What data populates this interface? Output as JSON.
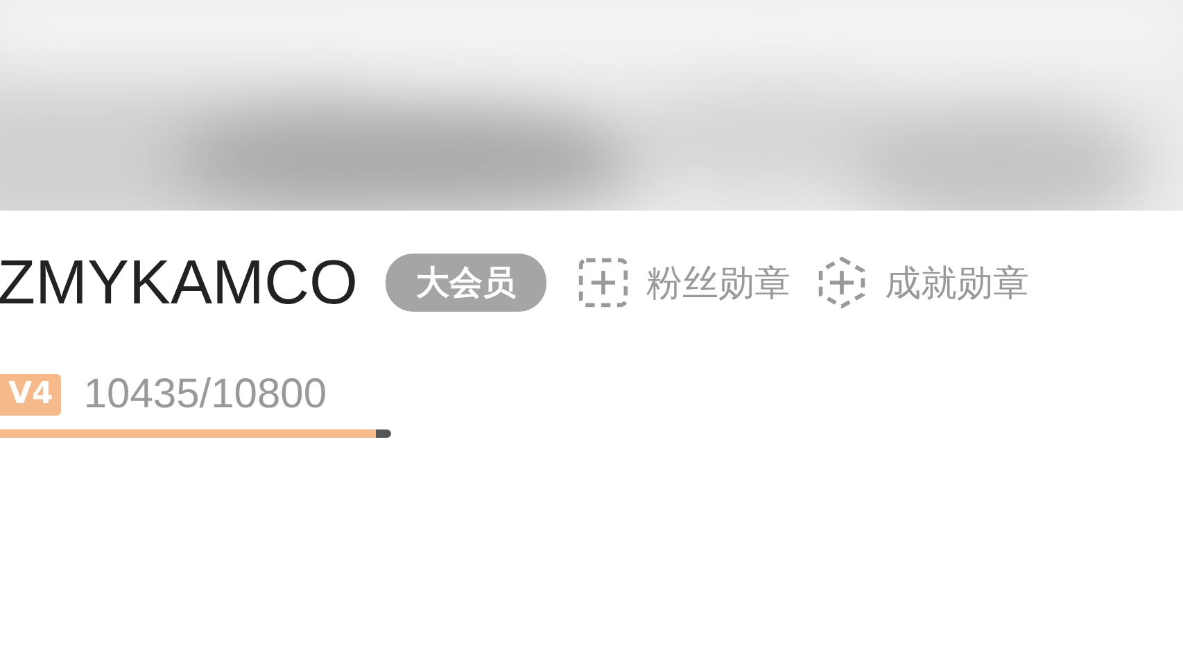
{
  "profile": {
    "name": "ZMYKAMCO",
    "vip_badge": "大会员",
    "medals": [
      {
        "kind": "square",
        "label": "粉丝勋章"
      },
      {
        "kind": "hexagon",
        "label": "成就勋章"
      }
    ]
  },
  "level": {
    "badge": "V4",
    "experience": "10435/10800",
    "level": 0.96
  }
}
